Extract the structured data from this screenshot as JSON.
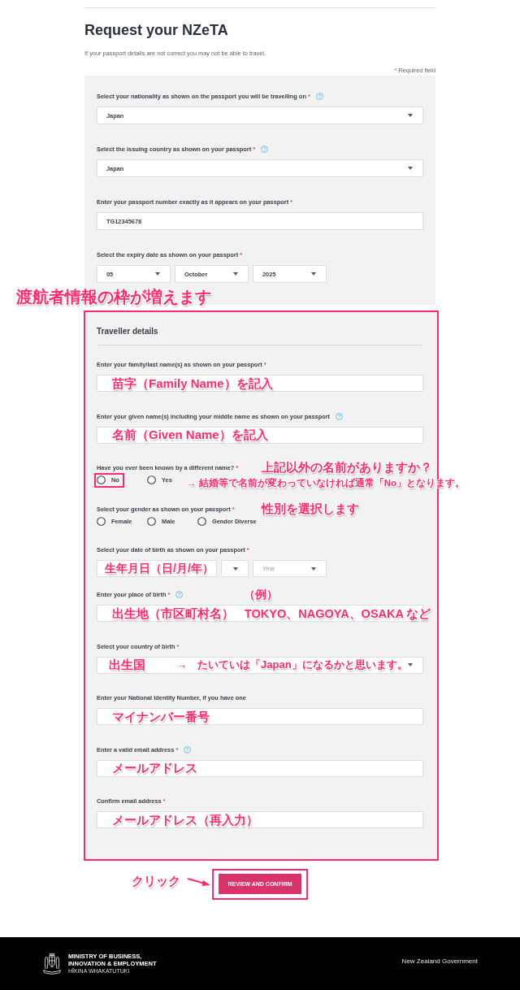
{
  "header": {
    "title": "Request your NZeTA",
    "intro": "If your passport details are not correct you may not be able to travel.",
    "required_note": {
      "mark": "*",
      "text": "Required field"
    }
  },
  "passport_details": {
    "fields": [
      {
        "kind": "select",
        "label": "Select your nationality as shown on the passport you will be travelling on",
        "required_mark": "*",
        "help": true,
        "value": "Japan"
      },
      {
        "kind": "select",
        "label": "Select the issuing country as shown on your passport",
        "required_mark": "*",
        "help": true,
        "value": "Japan"
      },
      {
        "kind": "text",
        "label": "Enter your passport number exactly as it appears on your passport",
        "required_mark": "*",
        "help": false,
        "value": "TG12345678"
      },
      {
        "kind": "date",
        "label": "Select the expiry date as shown on your passport",
        "required_mark": "*",
        "help": false,
        "parts": [
          {
            "value": "05",
            "caret": true
          },
          {
            "value": "October",
            "caret": true
          },
          {
            "value": "2025",
            "caret": true
          }
        ]
      }
    ]
  },
  "traveller_details": {
    "callout": "渡航者情報の枠が増えます",
    "highlighted": true,
    "title": "Traveller details",
    "fields": [
      {
        "kind": "text",
        "label": "Enter your family/last name(s) as shown on your passport",
        "required_mark": "*",
        "help": false,
        "note": "苗字（Family Name）を記入"
      },
      {
        "kind": "text",
        "label": "Enter your given name(s) including your middle name as shown on your passport",
        "help": true,
        "note": "名前（Given Name）を記入"
      },
      {
        "kind": "radio",
        "label": "Have you ever been known by a different name?",
        "required_mark": "*",
        "help": false,
        "side_note": "上記以外の名前がありますか？",
        "options": [
          {
            "label": "No",
            "selected": false,
            "highlighted": true
          },
          {
            "label": "Yes",
            "selected": false,
            "highlighted": false
          }
        ],
        "options_note": "→ 結婚等で名前が変わっていなければ通常「No」となります。"
      },
      {
        "kind": "radio",
        "label": "Select your gender as shown on your passport",
        "required_mark": "*",
        "help": false,
        "side_note": "性別を選択します",
        "options": [
          {
            "label": "Female",
            "selected": false,
            "highlighted": false
          },
          {
            "label": "Male",
            "selected": false,
            "highlighted": false
          },
          {
            "label": "Gender Diverse",
            "selected": false,
            "highlighted": false
          }
        ]
      },
      {
        "kind": "date",
        "label": "Select your date of birth as shown on your passport",
        "required_mark": "*",
        "help": false,
        "parts": [
          {
            "caret": false,
            "note": "生年月日（日/月/年）"
          },
          {
            "caret": true
          },
          {
            "placeholder": "Year",
            "caret": true
          }
        ]
      },
      {
        "kind": "text",
        "label": "Enter your place of birth",
        "required_mark": "*",
        "help": true,
        "note": "出生地（市区町村名）",
        "example_label": "（例）",
        "example": "TOKYO、NAGOYA、OSAKA など"
      },
      {
        "kind": "select",
        "label": "Select your country of birth",
        "required_mark": "*",
        "help": false,
        "note": "出生国",
        "note_detail": "→　たいていは「Japan」になるかと思います。"
      },
      {
        "kind": "text",
        "label": "Enter your National Identity Number, if you have one",
        "help": false,
        "note": "マイナンバー番号"
      },
      {
        "kind": "text",
        "label": "Enter a valid email address",
        "required_mark": "*",
        "help": true,
        "note": "メールアドレス"
      },
      {
        "kind": "text",
        "label": "Confirm email address",
        "required_mark": "*",
        "help": false,
        "note": "メールアドレス（再入力）"
      }
    ]
  },
  "submit": {
    "label": "REVIEW AND CONFIRM",
    "highlighted": true,
    "note": "クリック"
  },
  "footer": {
    "ministry": [
      "MINISTRY OF BUSINESS,",
      "INNOVATION & EMPLOYMENT"
    ],
    "motto": "HĪKINA WHAKATUTUKI",
    "government": "New Zealand Government"
  }
}
